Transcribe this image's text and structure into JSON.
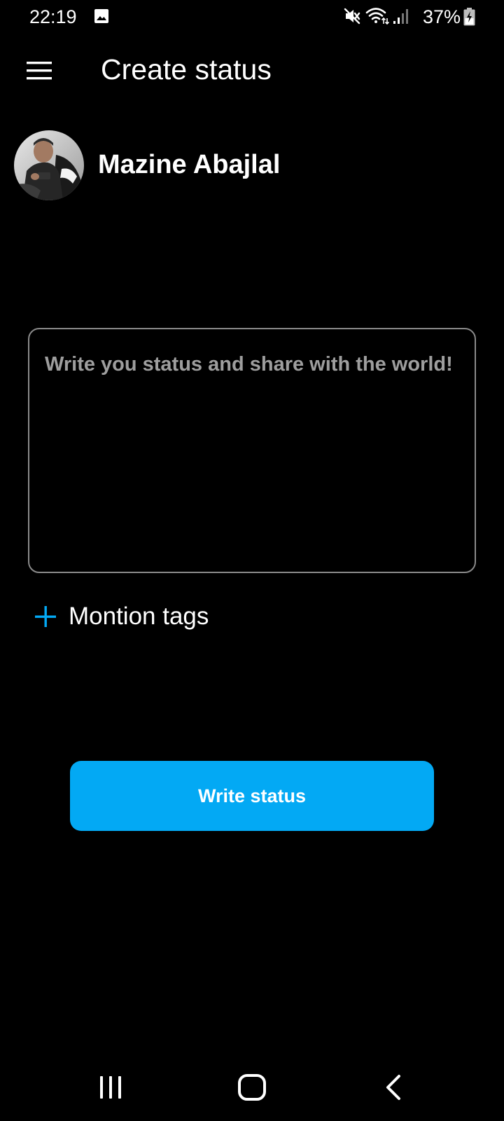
{
  "status_bar": {
    "time": "22:19",
    "battery_percent": "37%",
    "icons": [
      "image-notification-icon",
      "mute-icon",
      "wifi-icon",
      "signal-icon",
      "battery-charging-icon"
    ]
  },
  "app_bar": {
    "menu_icon": "hamburger-menu-icon",
    "title": "Create status"
  },
  "profile": {
    "name": "Mazine Abajlal"
  },
  "status_input": {
    "value": "",
    "placeholder": "Write you status and share with the world!"
  },
  "mention": {
    "icon": "plus-icon",
    "label": "Montion tags"
  },
  "submit_button": {
    "label": "Write status"
  },
  "nav_bar": {
    "icons": [
      "recent-apps-icon",
      "home-icon",
      "back-icon"
    ]
  },
  "colors": {
    "background": "#000000",
    "accent": "#03a9f4",
    "text": "#ffffff",
    "placeholder": "#9e9e9e",
    "input_border": "#8a8a8a"
  }
}
